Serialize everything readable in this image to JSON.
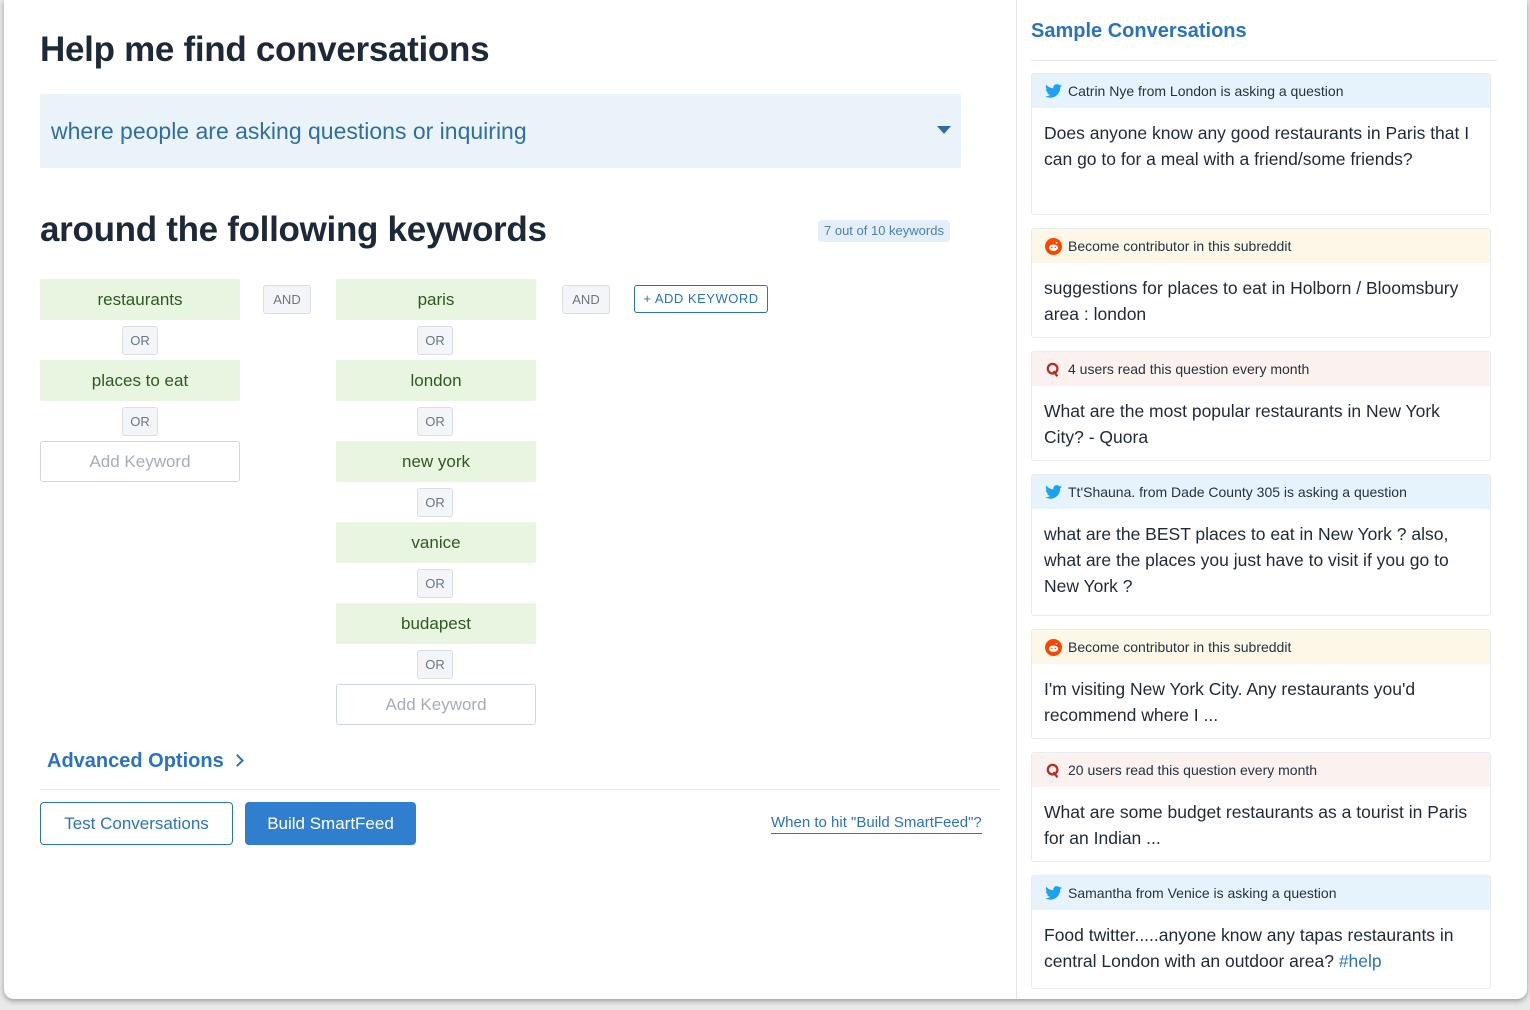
{
  "main": {
    "title": "Help me find conversations",
    "intent": {
      "selected": "where people are asking questions or inquiring"
    },
    "keywords_title": "around the following keywords",
    "keywords_count": "7 out of 10 keywords",
    "operators": {
      "or": "OR",
      "and": "AND"
    },
    "group1": {
      "keywords": [
        "restaurants",
        "places to eat"
      ],
      "add_placeholder": "Add Keyword"
    },
    "group2": {
      "keywords": [
        "paris",
        "london",
        "new york",
        "vanice",
        "budapest"
      ],
      "add_placeholder": "Add Keyword"
    },
    "add_keyword_button": "+ ADD KEYWORD",
    "advanced_options": "Advanced Options",
    "test_button": "Test Conversations",
    "build_button": "Build SmartFeed",
    "help_link": "When to hit \"Build SmartFeed\"?"
  },
  "sidebar": {
    "title": "Sample Conversations",
    "cards": [
      {
        "source": "twitter",
        "header": "Catrin Nye from London is asking a question",
        "body": "Does anyone know any good restaurants in Paris that I can go to for a meal with a friend/some friends?"
      },
      {
        "source": "reddit",
        "header": "Become contributor in this subreddit",
        "body": "suggestions for places to eat in Holborn / Bloomsbury area : london"
      },
      {
        "source": "quora",
        "header": "4 users read this question every month",
        "body": "What are the most popular restaurants in New York City? - Quora"
      },
      {
        "source": "twitter",
        "header": "Tt'Shauna. from Dade County 305 is asking a question",
        "body": "what are the BEST places to eat in New York ? also, what are the places you just have to visit if you go to New York ?"
      },
      {
        "source": "reddit",
        "header": "Become contributor in this subreddit",
        "body": "I'm visiting New York City. Any restaurants you'd recommend where I ..."
      },
      {
        "source": "quora",
        "header": "20 users read this question every month",
        "body": "What are some budget restaurants as a tourist in Paris for an Indian ..."
      },
      {
        "source": "twitter",
        "header": "Samantha from Venice is asking a question",
        "body": "Food twitter.....anyone know any tapas restaurants in central London with an outdoor area?",
        "hashtag": "#help"
      }
    ]
  },
  "colors": {
    "accent": "#2a73c1",
    "keyword_bg": "#e8f5e1",
    "twitter": "#1da1f2",
    "reddit": "#ff4500",
    "quora": "#b92b27"
  },
  "icons": {
    "twitter": "twitter-icon",
    "reddit": "reddit-icon",
    "quora": "quora-icon",
    "dropdown": "caret-down-icon",
    "advanced": "chevron-right-icon"
  }
}
